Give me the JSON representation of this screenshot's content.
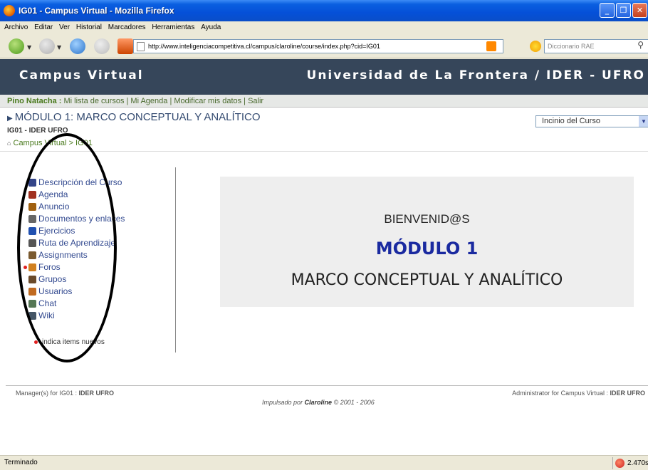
{
  "window": {
    "title": "IG01 - Campus Virtual - Mozilla Firefox"
  },
  "menu": [
    "Archivo",
    "Editar",
    "Ver",
    "Historial",
    "Marcadores",
    "Herramientas",
    "Ayuda"
  ],
  "nav": {
    "url": "http://www.inteligenciacompetitiva.cl/campus/claroline/course/index.php?cid=IG01",
    "search_placeholder": "Diccionario RAE"
  },
  "banner": {
    "left": "Campus Virtual",
    "right": "Universidad de La Frontera / IDER - UFRO"
  },
  "userbar": {
    "user": "Pino Natacha",
    "sep": " : ",
    "links": "Mi lista de cursos | Mi Agenda | Modificar mis datos | Salir"
  },
  "course": {
    "title": "MÓDULO 1: MARCO CONCEPTUAL Y ANALÍTICO",
    "code": "IG01 - IDER UFRO",
    "select_value": "Incinio del Curso"
  },
  "breadcrumb": {
    "root": "Campus Virtual",
    "sep": " > ",
    "current": "IG01"
  },
  "tools": [
    {
      "label": "Descripción del Curso",
      "icon": "list-icon",
      "color": "#334488",
      "new": false
    },
    {
      "label": "Agenda",
      "icon": "calendar-icon",
      "color": "#a03020",
      "new": false
    },
    {
      "label": "Anuncio",
      "icon": "announcement-icon",
      "color": "#a06010",
      "new": false
    },
    {
      "label": "Documentos y enlaces",
      "icon": "documents-icon",
      "color": "#666666",
      "new": false
    },
    {
      "label": "Ejercicios",
      "icon": "checkbox-icon",
      "color": "#2050b0",
      "new": false
    },
    {
      "label": "Ruta de Aprendizaje",
      "icon": "path-icon",
      "color": "#555555",
      "new": false
    },
    {
      "label": "Assignments",
      "icon": "assignment-icon",
      "color": "#7a5a30",
      "new": false
    },
    {
      "label": "Foros",
      "icon": "forum-icon",
      "color": "#d08020",
      "new": true
    },
    {
      "label": "Grupos",
      "icon": "groups-icon",
      "color": "#6a4a2a",
      "new": false
    },
    {
      "label": "Usuarios",
      "icon": "users-icon",
      "color": "#c06a20",
      "new": false
    },
    {
      "label": "Chat",
      "icon": "chat-icon",
      "color": "#557755",
      "new": false
    },
    {
      "label": "Wiki",
      "icon": "wiki-icon",
      "color": "#445566",
      "new": false
    }
  ],
  "legend": "indica items nuevos",
  "welcome": {
    "line1": "BIENVENID@S",
    "line2": "MÓDULO 1",
    "line3": "MARCO CONCEPTUAL Y ANALÍTICO"
  },
  "footer": {
    "left_prefix": "Manager(s) for IG01 : ",
    "left_bold": "IDER UFRO",
    "right_prefix": "Administrator for Campus Virtual : ",
    "right_bold": "IDER UFRO",
    "center_prefix": "Impulsado por ",
    "center_bold": "Claroline",
    "center_suffix": " © 2001 - 2006"
  },
  "status": {
    "text": "Terminado",
    "right": "2.470s"
  }
}
